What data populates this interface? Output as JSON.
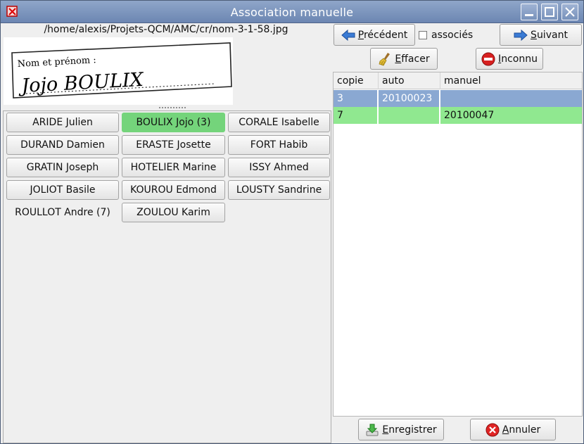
{
  "window": {
    "title": "Association manuelle"
  },
  "file_path": "/home/alexis/Projets-QCM/AMC/cr/nom-3-1-58.jpg",
  "scan": {
    "label": "Nom et prénom :",
    "handwriting": "Jojo BOULIX"
  },
  "students": [
    {
      "label": "ARIDE Julien",
      "state": "normal"
    },
    {
      "label": "BOULIX Jojo (3)",
      "state": "selected"
    },
    {
      "label": "CORALE Isabelle",
      "state": "normal"
    },
    {
      "label": "DURAND Damien",
      "state": "normal"
    },
    {
      "label": "ERASTE Josette",
      "state": "normal"
    },
    {
      "label": "FORT Habib",
      "state": "normal"
    },
    {
      "label": "GRATIN Joseph",
      "state": "normal"
    },
    {
      "label": "HOTELIER Marine",
      "state": "normal"
    },
    {
      "label": "ISSY Ahmed",
      "state": "normal"
    },
    {
      "label": "JOLIOT Basile",
      "state": "normal"
    },
    {
      "label": "KOUROU Edmond",
      "state": "normal"
    },
    {
      "label": "LOUSTY Sandrine",
      "state": "normal"
    },
    {
      "label": "ROULLOT Andre (7)",
      "state": "flat"
    },
    {
      "label": "ZOULOU Karim",
      "state": "normal"
    }
  ],
  "toolbar": {
    "previous": {
      "mnemonic": "P",
      "rest": "récédent"
    },
    "associated_label": "associés",
    "next": {
      "mnemonic": "S",
      "rest": "uivant"
    },
    "clear": {
      "mnemonic": "E",
      "rest": "ffacer"
    },
    "unknown": {
      "mnemonic": "I",
      "rest": "nconnu"
    }
  },
  "table": {
    "headers": [
      "copie",
      "auto",
      "manuel"
    ],
    "rows": [
      {
        "copie": "3",
        "auto": "20100023",
        "manuel": "",
        "state": "selected"
      },
      {
        "copie": "7",
        "auto": "",
        "manuel": "20100047",
        "state": "matched"
      }
    ]
  },
  "footer": {
    "save": {
      "mnemonic": "E",
      "rest": "nregistrer"
    },
    "cancel": {
      "mnemonic": "A",
      "rest": "nnuler"
    }
  },
  "colors": {
    "selected_row": "#8aa8d2",
    "matched_row": "#90e890",
    "selected_student": "#74d47b"
  }
}
